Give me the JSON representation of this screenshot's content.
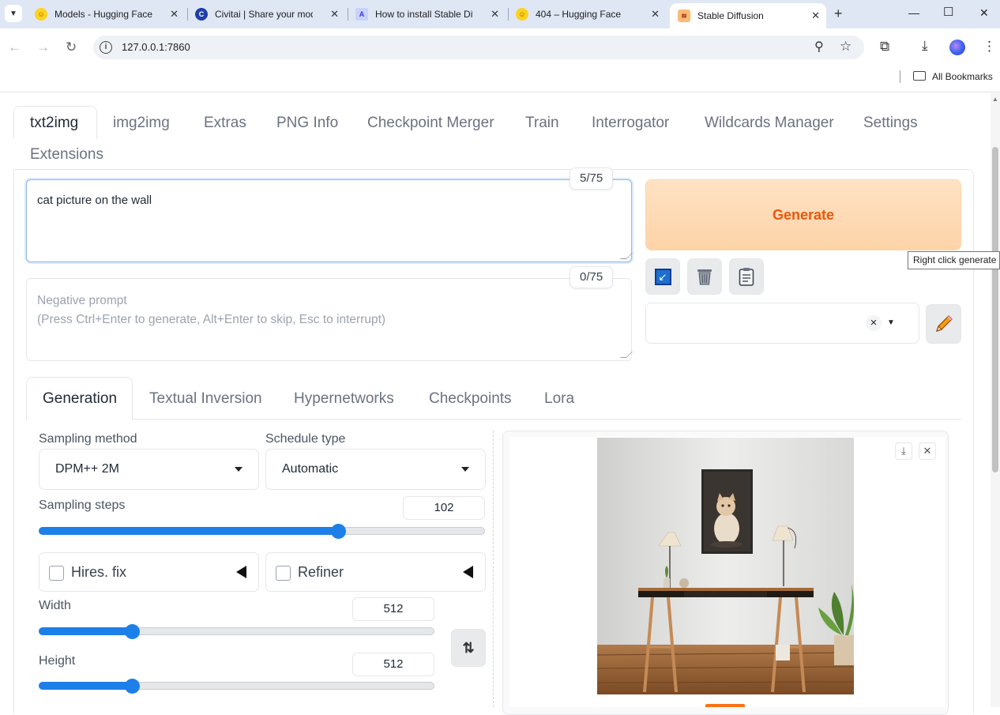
{
  "browser": {
    "tabs": [
      {
        "title": "Models - Hugging Face"
      },
      {
        "title": "Civitai | Share your models"
      },
      {
        "title": "How to install Stable Diffusion"
      },
      {
        "title": "404 – Hugging Face"
      },
      {
        "title": "Stable Diffusion"
      }
    ],
    "url": "127.0.0.1:7860",
    "bookmarks_label": "All Bookmarks"
  },
  "app_tabs": [
    "txt2img",
    "img2img",
    "Extras",
    "PNG Info",
    "Checkpoint Merger",
    "Train",
    "Interrogator",
    "Wildcards Manager",
    "Settings",
    "Extensions"
  ],
  "prompt": {
    "text": "cat picture on the wall",
    "counter": "5/75"
  },
  "negative_prompt": {
    "placeholder_line1": "Negative prompt",
    "placeholder_line2": "(Press Ctrl+Enter to generate, Alt+Enter to skip, Esc to interrupt)",
    "counter": "0/75"
  },
  "generate": {
    "label": "Generate",
    "tooltip": "Right click generate f"
  },
  "sub_tabs": [
    "Generation",
    "Textual Inversion",
    "Hypernetworks",
    "Checkpoints",
    "Lora"
  ],
  "generation": {
    "sampling_method_label": "Sampling method",
    "sampling_method_value": "DPM++ 2M",
    "schedule_type_label": "Schedule type",
    "schedule_type_value": "Automatic",
    "sampling_steps_label": "Sampling steps",
    "sampling_steps_value": "102",
    "sampling_steps_fraction": 0.67,
    "hires_fix_label": "Hires. fix",
    "refiner_label": "Refiner",
    "width_label": "Width",
    "width_value": "512",
    "width_fraction": 0.235,
    "height_label": "Height",
    "height_value": "512",
    "height_fraction": 0.235
  },
  "colors": {
    "accent": "#1d7fe8",
    "generate_text": "#ea580c",
    "generate_bg": "#fed3a8"
  }
}
